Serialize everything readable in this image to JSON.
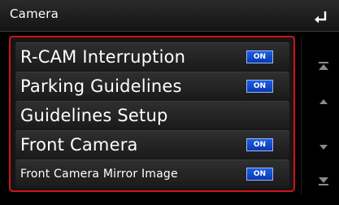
{
  "header": {
    "title": "Camera"
  },
  "settings": {
    "items": [
      {
        "label": "R-CAM Interruption",
        "toggle": "ON",
        "has_toggle": true
      },
      {
        "label": "Parking Guidelines",
        "toggle": "ON",
        "has_toggle": true
      },
      {
        "label": "Guidelines Setup",
        "has_toggle": false
      },
      {
        "label": "Front Camera",
        "toggle": "ON",
        "has_toggle": true
      },
      {
        "label": "Front Camera Mirror Image",
        "toggle": "ON",
        "has_toggle": true
      }
    ]
  },
  "colors": {
    "selection_frame": "#d0121b",
    "toggle_on": "#1a5fe6",
    "background": "#000000"
  },
  "icons": [
    "back-arrow-icon",
    "scroll-top-icon",
    "scroll-up-icon",
    "scroll-down-icon",
    "scroll-bottom-icon"
  ]
}
